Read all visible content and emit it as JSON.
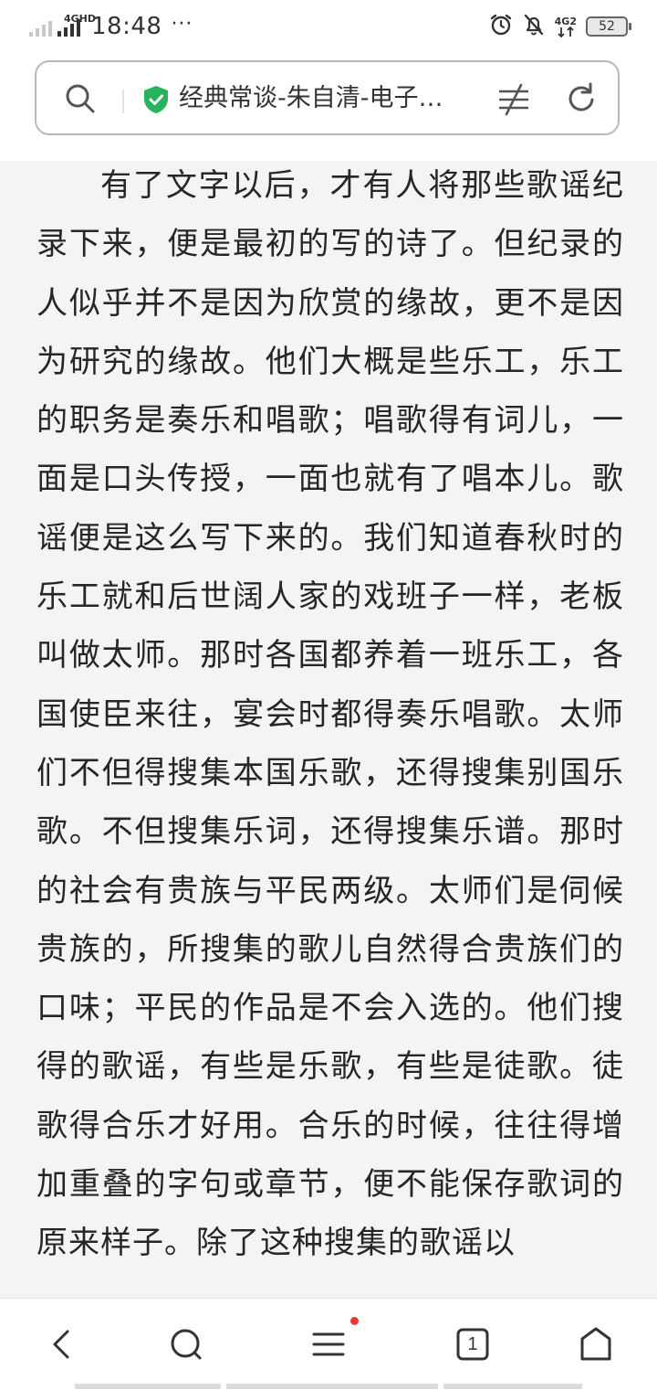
{
  "status_bar": {
    "network_label": "4GHD",
    "time": "18:48",
    "more": "···",
    "network2_label": "4G2",
    "battery": "52"
  },
  "address_bar": {
    "page_title": "经典常谈-朱自清-电子…"
  },
  "article": {
    "paragraph": "有了文字以后，才有人将那些歌谣纪录下来，便是最初的写的诗了。但纪录的人似乎并不是因为欣赏的缘故，更不是因为研究的缘故。他们大概是些乐工，乐工的职务是奏乐和唱歌；唱歌得有词儿，一面是口头传授，一面也就有了唱本儿。歌谣便是这么写下来的。我们知道春秋时的乐工就和后世阔人家的戏班子一样，老板叫做太师。那时各国都养着一班乐工，各国使臣来往，宴会时都得奏乐唱歌。太师们不但得搜集本国乐歌，还得搜集别国乐歌。不但搜集乐词，还得搜集乐谱。那时的社会有贵族与平民两级。太师们是伺候贵族的，所搜集的歌儿自然得合贵族们的口味；平民的作品是不会入选的。他们搜得的歌谣，有些是乐歌，有些是徒歌。徒歌得合乐才好用。合乐的时候，往往得增加重叠的字句或章节，便不能保存歌词的原来样子。除了这种搜集的歌谣以"
  },
  "bottom_nav": {
    "tabs_count": "1"
  },
  "icons": {
    "status": [
      "signal-icon",
      "alarm-icon",
      "mute-icon",
      "battery-icon"
    ],
    "address_bar": [
      "search-icon",
      "secure-shield-icon",
      "reader-mode-icon",
      "refresh-icon"
    ],
    "bottom_nav": [
      "back-icon",
      "search-icon",
      "menu-icon",
      "tabs-icon",
      "home-icon"
    ]
  },
  "colors": {
    "secure_green": "#27b35b",
    "notification_dot": "#e53935",
    "content_background": "#f4f4f4"
  }
}
